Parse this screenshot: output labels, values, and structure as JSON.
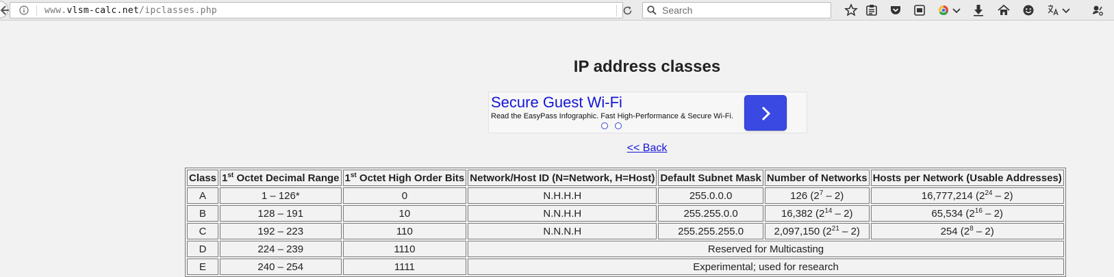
{
  "browser": {
    "url_prefix": "www.",
    "url_host": "vlsm-calc.net",
    "url_path": "/ipclasses.php",
    "search_placeholder": "Search"
  },
  "page": {
    "title": "IP address classes",
    "back_link": "<< Back"
  },
  "ad": {
    "title": "Secure Guest Wi-Fi",
    "description": "Read the EasyPass Infographic. Fast High-Performance & Secure Wi-Fi.",
    "accent_color": "#3a49e2"
  },
  "table": {
    "headers": {
      "class": "Class",
      "range_pre": "1",
      "range_sup": "st",
      "range_post": " Octet Decimal Range",
      "bits_pre": "1",
      "bits_sup": "st",
      "bits_post": " Octet High Order Bits",
      "netid": "Network/Host ID (N=Network, H=Host)",
      "mask": "Default Subnet Mask",
      "networks": "Number of Networks",
      "hosts": "Hosts per Network (Usable Addresses)"
    },
    "rows": [
      {
        "class": "A",
        "range": "1 – 126*",
        "bits": "0",
        "netid": "N.H.H.H",
        "mask": "255.0.0.0",
        "networks_pre": "126 (2",
        "networks_sup": "7",
        "networks_post": " – 2)",
        "hosts_pre": "16,777,214 (2",
        "hosts_sup": "24",
        "hosts_post": " – 2)"
      },
      {
        "class": "B",
        "range": "128 – 191",
        "bits": "10",
        "netid": "N.N.H.H",
        "mask": "255.255.0.0",
        "networks_pre": "16,382 (2",
        "networks_sup": "14",
        "networks_post": " – 2)",
        "hosts_pre": "65,534 (2",
        "hosts_sup": "16",
        "hosts_post": " – 2)"
      },
      {
        "class": "C",
        "range": "192 – 223",
        "bits": "110",
        "netid": "N.N.N.H",
        "mask": "255.255.255.0",
        "networks_pre": "2,097,150 (2",
        "networks_sup": "21",
        "networks_post": " – 2)",
        "hosts_pre": "254 (2",
        "hosts_sup": "8",
        "hosts_post": " – 2)"
      },
      {
        "class": "D",
        "range": "224 – 239",
        "bits": "1110",
        "note": "Reserved for Multicasting"
      },
      {
        "class": "E",
        "range": "240 – 254",
        "bits": "1111",
        "note": "Experimental; used for research"
      }
    ]
  },
  "toolbar_icons": [
    "bookmark-star-icon",
    "reading-list-icon",
    "pocket-icon",
    "screenshot-icon",
    "chrome-extension-icon",
    "dropdown-chevron-icon",
    "download-icon",
    "home-icon",
    "emoji-icon",
    "translate-icon",
    "dropdown-chevron-icon",
    "extension-icon"
  ]
}
